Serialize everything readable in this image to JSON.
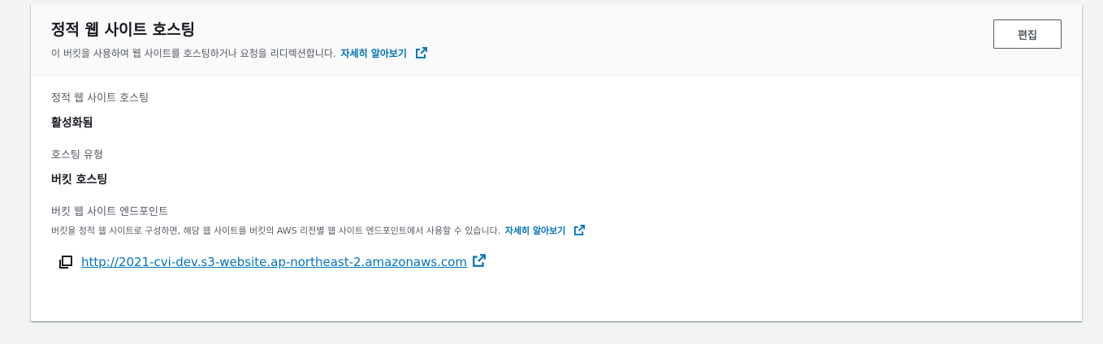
{
  "header": {
    "title": "정적 웹 사이트 호스팅",
    "description": "이 버킷을 사용하여 웹 사이트를 호스팅하거나 요청을 리디렉션합니다.",
    "learn_more": "자세히 알아보기",
    "edit_label": "편집"
  },
  "fields": {
    "hosting": {
      "label": "정적 웹 사이트 호스팅",
      "value": "활성화됨"
    },
    "hosting_type": {
      "label": "호스팅 유형",
      "value": "버킷 호스팅"
    },
    "endpoint": {
      "label": "버킷 웹 사이트 엔드포인트",
      "description": "버킷을 정적 웹 사이트로 구성하면, 해당 웹 사이트를 버킷의 AWS 리전별 웹 사이트 엔드포인트에서 사용할 수 있습니다.",
      "learn_more": "자세히 알아보기",
      "url": "http://2021-cvi-dev.s3-website.ap-northeast-2.amazonaws.com"
    }
  },
  "icons": {
    "external": "external-link-icon",
    "copy": "copy-icon"
  },
  "colors": {
    "link": "#0073bb",
    "text": "#16191f",
    "secondary": "#545b64",
    "header_bg": "#fafafa",
    "page_bg": "#f2f3f3"
  }
}
